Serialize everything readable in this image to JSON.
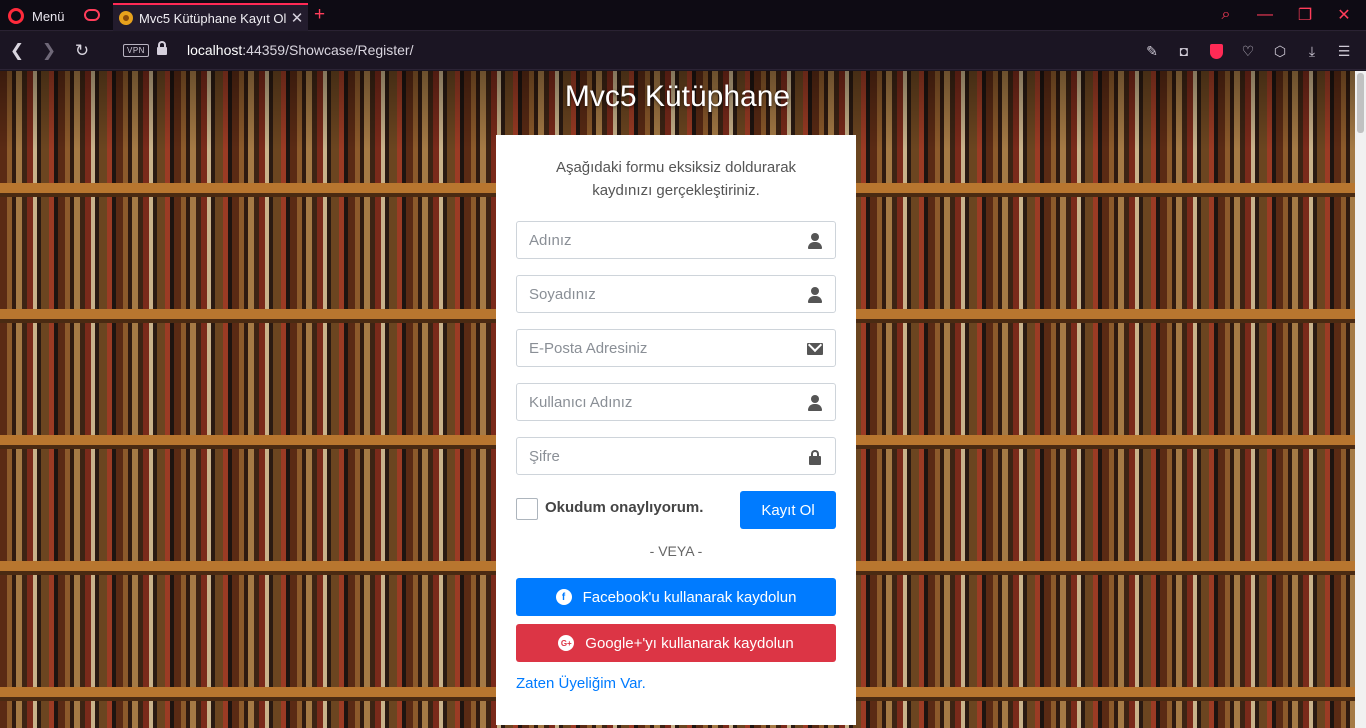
{
  "browser": {
    "menu_label": "Menü",
    "tab_title": "Mvc5 Kütüphane Kayıt Ol",
    "tab_close": "✕",
    "new_tab": "+",
    "vpn_label": "VPN",
    "url_host": "localhost",
    "url_rest": ":44359/Showcase/Register/",
    "window_controls": {
      "search": "⌕",
      "minimize": "—",
      "restore": "❐",
      "close": "✕"
    },
    "nav": {
      "back": "❮",
      "forward": "❯",
      "reload": "↻"
    }
  },
  "page": {
    "brand": "Mvc5 Kütüphane",
    "intro": "Aşağıdaki formu eksiksiz doldurarak kaydınızı gerçekleştiriniz.",
    "fields": {
      "first_name": {
        "placeholder": "Adınız",
        "icon": "user-icon"
      },
      "last_name": {
        "placeholder": "Soyadınız",
        "icon": "user-icon"
      },
      "email": {
        "placeholder": "E-Posta Adresiniz",
        "icon": "envelope-icon"
      },
      "username": {
        "placeholder": "Kullanıcı Adınız",
        "icon": "user-icon"
      },
      "password": {
        "placeholder": "Şifre",
        "icon": "lock-icon"
      }
    },
    "agree_label": "Okudum onaylıyorum.",
    "register_button": "Kayıt Ol",
    "divider": "- VEYA -",
    "facebook_button": "Facebook'u kullanarak kaydolun",
    "google_button": "Google+'yı kullanarak kaydolun",
    "login_link": "Zaten Üyeliğim Var."
  },
  "colors": {
    "primary": "#007bff",
    "danger": "#dc3545",
    "browser_accent": "#ff2a55"
  }
}
